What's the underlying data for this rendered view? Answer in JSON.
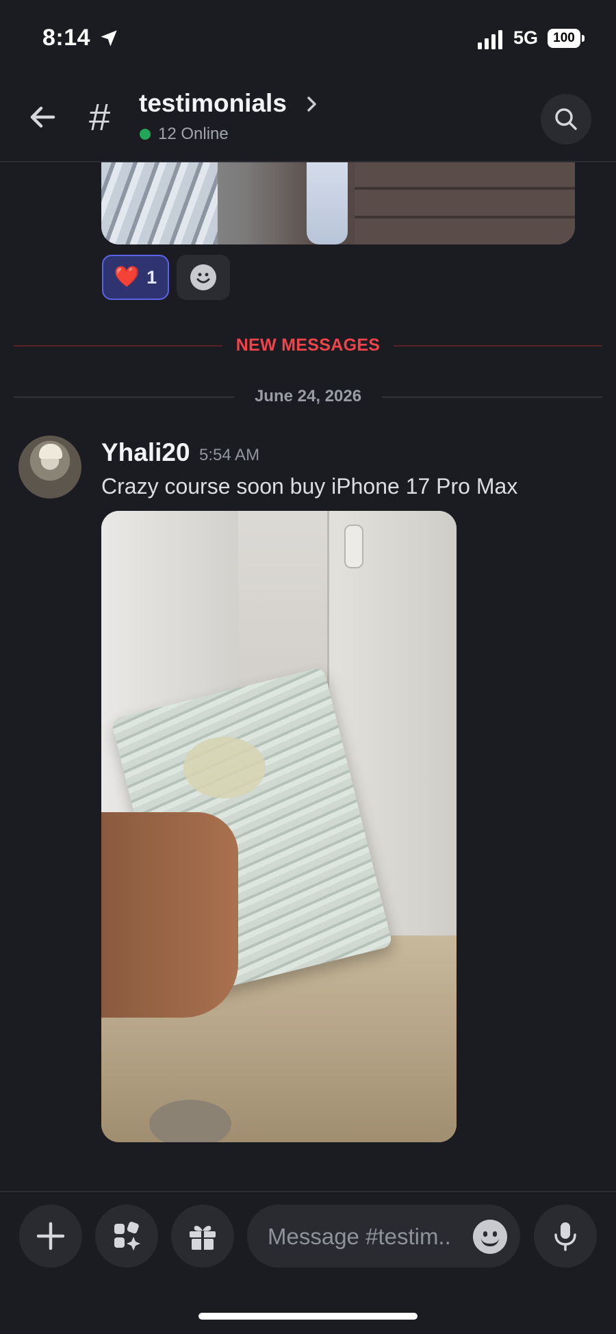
{
  "status_bar": {
    "time": "8:14",
    "network": "5G",
    "battery": "100"
  },
  "header": {
    "channel_name": "testimonials",
    "online_count": "12 Online"
  },
  "reactions": [
    {
      "emoji": "❤️",
      "count": "1"
    }
  ],
  "dividers": {
    "new_messages": "NEW MESSAGES",
    "date": "June 24, 2026"
  },
  "message": {
    "author": "Yhali20",
    "timestamp": "5:54 AM",
    "text": "Crazy course soon buy iPhone 17 Pro Max"
  },
  "composer": {
    "placeholder": "Message #testim.."
  },
  "colors": {
    "background": "#1b1c21",
    "online": "#23a55a",
    "new_messages": "#f2434a",
    "reaction_bg": "#2f3470",
    "reaction_border": "#5b64e6"
  }
}
